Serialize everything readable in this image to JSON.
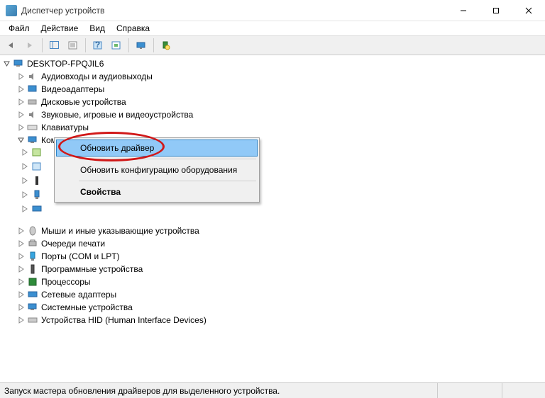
{
  "window": {
    "title": "Диспетчер устройств"
  },
  "menubar": {
    "file": "Файл",
    "action": "Действие",
    "view": "Вид",
    "help": "Справка"
  },
  "tree": {
    "root": "DESKTOP-FPQJIL6",
    "nodes": {
      "audio": "Аудиовходы и аудиовыходы",
      "video": "Видеоадаптеры",
      "disks": "Дисковые устройства",
      "soundgame": "Звуковые, игровые и видеоустройства",
      "keyboards": "Клавиатуры",
      "computer": "Компьютер",
      "mice": "Мыши и иные указывающие устройства",
      "printqueues": "Очереди печати",
      "ports": "Порты (COM и LPT)",
      "software": "Программные устройства",
      "processors": "Процессоры",
      "netadapters": "Сетевые адаптеры",
      "sysdevices": "Системные устройства",
      "hid": "Устройства HID (Human Interface Devices)"
    }
  },
  "context_menu": {
    "update_driver": "Обновить драйвер",
    "scan_hardware": "Обновить конфигурацию оборудования",
    "properties": "Свойства"
  },
  "statusbar": {
    "text": "Запуск мастера обновления драйверов для выделенного устройства."
  }
}
